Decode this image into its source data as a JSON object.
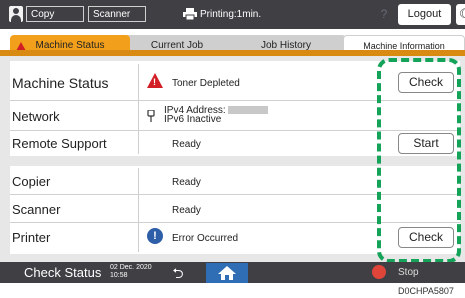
{
  "topbar": {
    "copy_label": "Copy",
    "scanner_label": "Scanner",
    "printing_status": "Printing:1min.",
    "help_label": "?",
    "logout_label": "Logout"
  },
  "tabs": [
    {
      "label": "Machine Status"
    },
    {
      "label": "Current Job"
    },
    {
      "label": "Job History"
    },
    {
      "label": "Machine Information"
    }
  ],
  "rows": {
    "machine_status": {
      "label": "Machine Status",
      "value": "Toner Depleted",
      "button": "Check"
    },
    "network": {
      "label": "Network",
      "value_line1": "IPv4 Address:",
      "value_line2": "IPv6 Inactive"
    },
    "remote_support": {
      "label": "Remote Support",
      "value": "Ready",
      "button": "Start"
    },
    "copier": {
      "label": "Copier",
      "value": "Ready"
    },
    "scanner": {
      "label": "Scanner",
      "value": "Ready"
    },
    "printer": {
      "label": "Printer",
      "value": "Error Occurred",
      "button": "Check"
    }
  },
  "bottombar": {
    "check_status_label": "Check Status",
    "date": "02 Dec. 2020",
    "time": "10:58",
    "stop_label": "Stop"
  },
  "footnote": "D0CHPA5807",
  "colors": {
    "accent_orange": "#f2a01c",
    "warning_red": "#d21f26",
    "info_blue": "#2f5ea8",
    "highlight_green": "#15a35a",
    "bar_dark": "#3f3f44"
  }
}
